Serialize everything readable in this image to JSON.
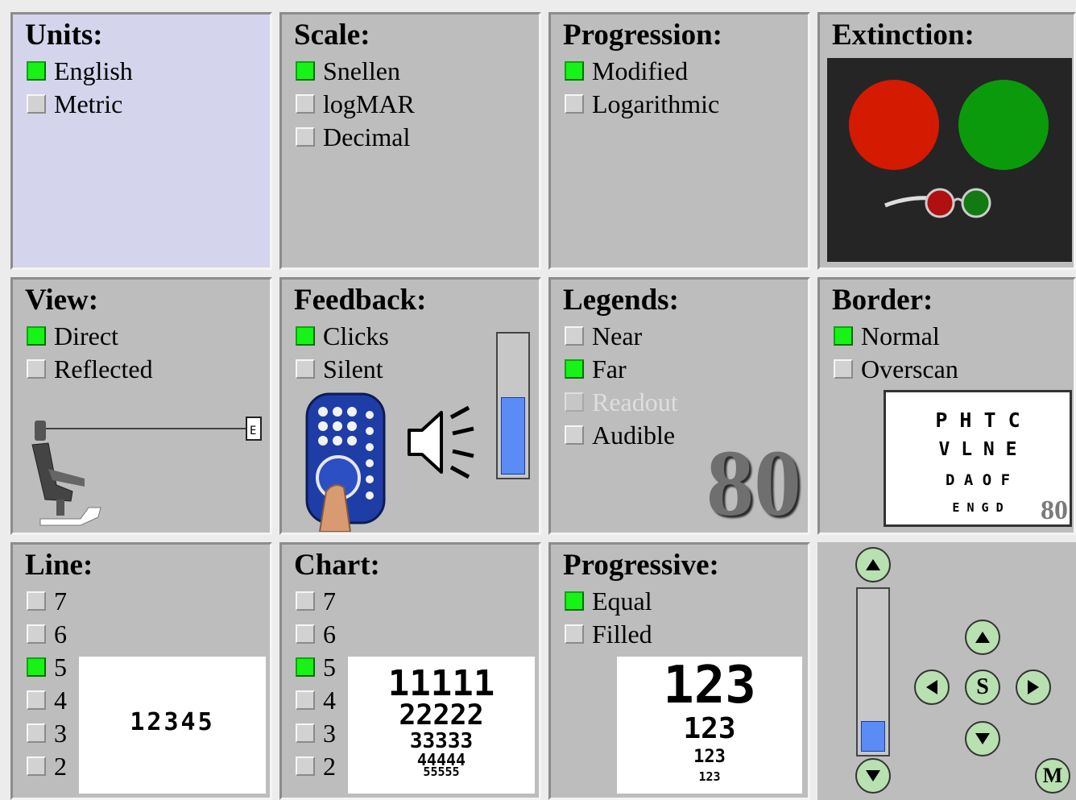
{
  "units": {
    "title": "Units:",
    "options": [
      {
        "label": "English",
        "checked": true
      },
      {
        "label": "Metric",
        "checked": false
      }
    ]
  },
  "scale": {
    "title": "Scale:",
    "options": [
      {
        "label": "Snellen",
        "checked": true
      },
      {
        "label": "logMAR",
        "checked": false
      },
      {
        "label": "Decimal",
        "checked": false
      }
    ]
  },
  "progression": {
    "title": "Progression:",
    "options": [
      {
        "label": "Modified",
        "checked": true
      },
      {
        "label": "Logarithmic",
        "checked": false
      }
    ]
  },
  "extinction": {
    "title": "Extinction:"
  },
  "view": {
    "title": "View:",
    "options": [
      {
        "label": "Direct",
        "checked": true
      },
      {
        "label": "Reflected",
        "checked": false
      }
    ]
  },
  "feedback": {
    "title": "Feedback:",
    "options": [
      {
        "label": "Clicks",
        "checked": true
      },
      {
        "label": "Silent",
        "checked": false
      }
    ],
    "volume_level": 0.55
  },
  "legends": {
    "title": "Legends:",
    "options": [
      {
        "label": "Near",
        "checked": false
      },
      {
        "label": "Far",
        "checked": true
      },
      {
        "label": "Readout",
        "checked": false,
        "disabled": true
      },
      {
        "label": "Audible",
        "checked": false
      }
    ],
    "big_number": "80"
  },
  "border": {
    "title": "Border:",
    "options": [
      {
        "label": "Normal",
        "checked": true
      },
      {
        "label": "Overscan",
        "checked": false
      }
    ],
    "chart_rows": [
      "P H T C",
      "V L N E",
      "D A O F",
      "E N G D"
    ],
    "chart_number": "80"
  },
  "line": {
    "title": "Line:",
    "options": [
      {
        "label": "7",
        "checked": false
      },
      {
        "label": "6",
        "checked": false
      },
      {
        "label": "5",
        "checked": true
      },
      {
        "label": "4",
        "checked": false
      },
      {
        "label": "3",
        "checked": false
      },
      {
        "label": "2",
        "checked": false
      }
    ],
    "preview": "12345"
  },
  "chart": {
    "title": "Chart:",
    "options": [
      {
        "label": "7",
        "checked": false
      },
      {
        "label": "6",
        "checked": false
      },
      {
        "label": "5",
        "checked": true
      },
      {
        "label": "4",
        "checked": false
      },
      {
        "label": "3",
        "checked": false
      },
      {
        "label": "2",
        "checked": false
      }
    ],
    "preview_rows": [
      "11111",
      "22222",
      "33333",
      "44444",
      "55555"
    ]
  },
  "progressive": {
    "title": "Progressive:",
    "options": [
      {
        "label": "Equal",
        "checked": true
      },
      {
        "label": "Filled",
        "checked": false
      }
    ],
    "preview_rows": [
      "123",
      "123",
      "123",
      "123"
    ]
  },
  "controls": {
    "slider_level": 0.18,
    "center_label": "S",
    "menu_label": "M"
  },
  "colors": {
    "check_on": "#17f317",
    "panel": "#bdbdbd",
    "selected_panel": "#d4d4ec",
    "volume": "#5b8bf4",
    "red": "#d41a00",
    "green": "#0b9a0b"
  }
}
